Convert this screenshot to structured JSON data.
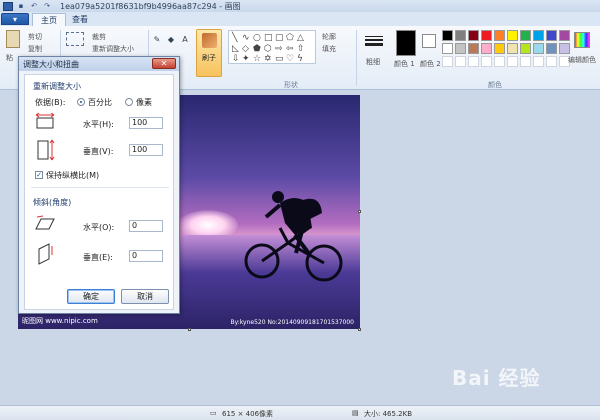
{
  "window": {
    "title": "1ea079a5201f8631bf9b4996aa87c294 - 画图"
  },
  "tabs": {
    "file": "▾",
    "items": [
      {
        "label": "主页",
        "active": true
      },
      {
        "label": "查看",
        "active": false
      }
    ]
  },
  "ribbon": {
    "paste_label": "粘",
    "cut_label": "剪切",
    "copy_label": "复制",
    "crop_label": "裁剪",
    "resize_label": "重新调整大小",
    "brush_label": "刷子",
    "outline_label": "轮廓",
    "fill_label": "填充",
    "size_label": "粗细",
    "color1_label": "颜色 1",
    "color2_label": "颜色 2",
    "edit_colors_label": "编辑颜色",
    "shapes_group": "形状",
    "colors_group": "颜色",
    "color1": "#000000",
    "color2": "#ffffff",
    "palette_row1": [
      "#000000",
      "#7f7f7f",
      "#880015",
      "#ed1c24",
      "#ff7f27",
      "#fff200",
      "#22b14c",
      "#00a2e8",
      "#3f48cc",
      "#a349a4"
    ],
    "palette_row2": [
      "#ffffff",
      "#c3c3c3",
      "#b97a57",
      "#ffaec9",
      "#ffc90e",
      "#efe4b0",
      "#b5e61d",
      "#99d9ea",
      "#7092be",
      "#c8bfe7"
    ]
  },
  "dialog": {
    "title": "调整大小和扭曲",
    "close": "✕",
    "resize_section": "重新调整大小",
    "basis_label": "依据(B):",
    "percent_label": "百分比",
    "pixels_label": "像素",
    "horizontal_label": "水平(H):",
    "horizontal_value": "100",
    "vertical_label": "垂直(V):",
    "vertical_value": "100",
    "keep_ratio_label": "保持纵横比(M)",
    "keep_ratio_mark": "✓",
    "skew_section": "倾斜(角度)",
    "skew_h_label": "水平(O):",
    "skew_h_value": "0",
    "skew_v_label": "垂直(E):",
    "skew_v_value": "0",
    "ok": "确定",
    "cancel": "取消"
  },
  "canvas": {
    "watermark_left": "昵图网 www.nipic.com",
    "watermark_right": "By:kyne520 No:20140909181701537000"
  },
  "statusbar": {
    "dimensions": "615 × 406像素",
    "size": "大小: 465.2KB"
  },
  "brand_watermark": "Bai 经验"
}
